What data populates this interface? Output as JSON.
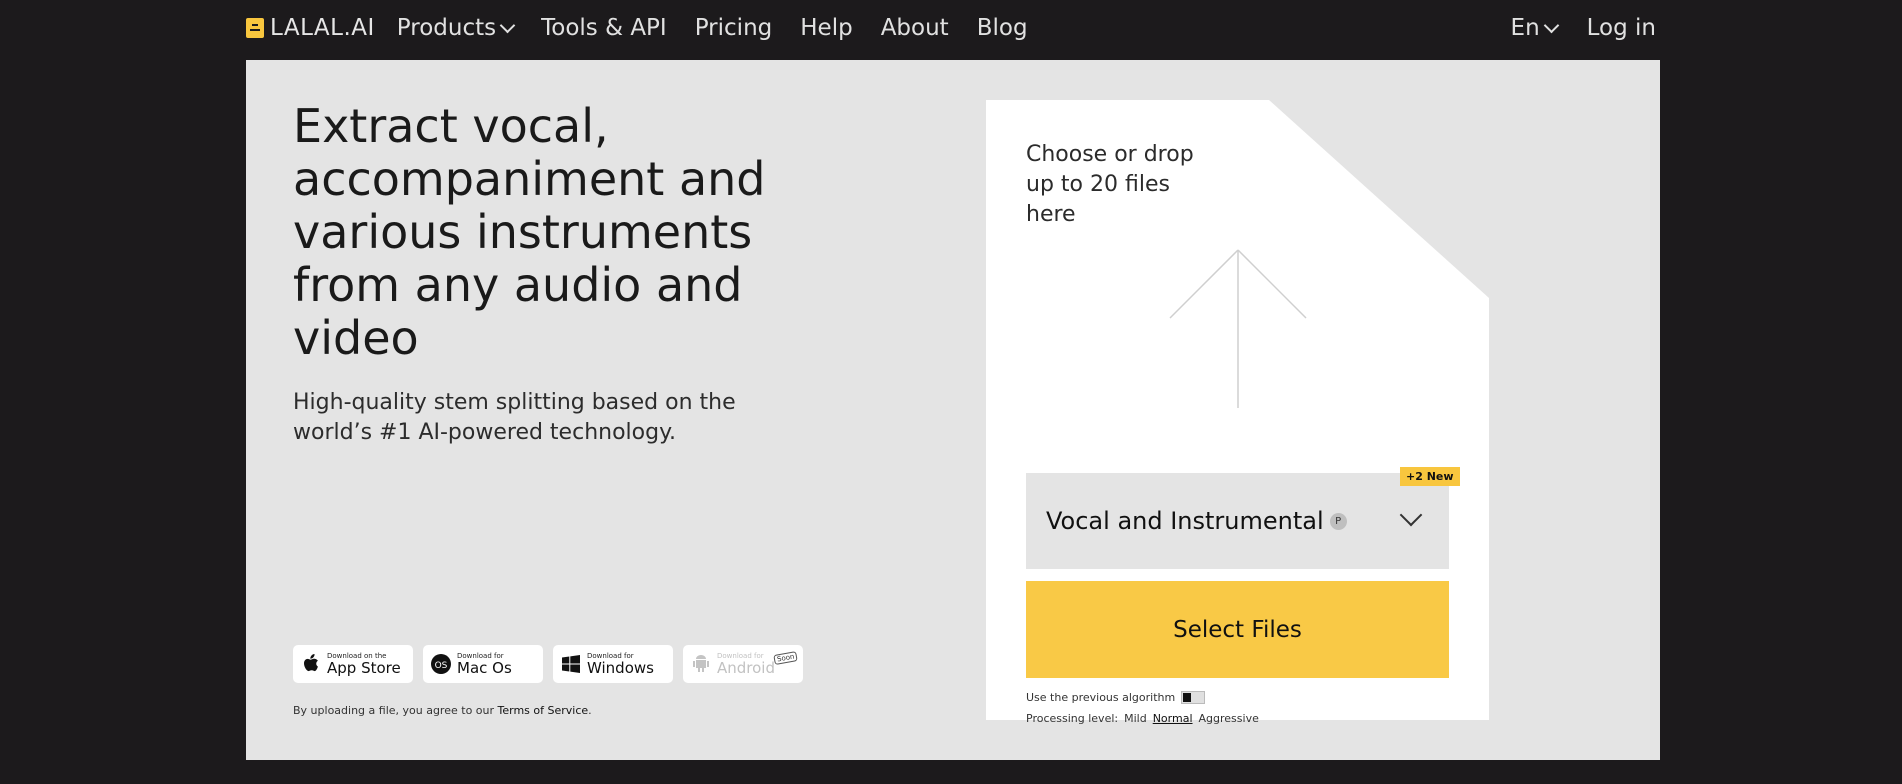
{
  "header": {
    "logo": "LALAL.AI",
    "nav": [
      {
        "label": "Products",
        "dropdown": true
      },
      {
        "label": "Tools & API"
      },
      {
        "label": "Pricing"
      },
      {
        "label": "Help"
      },
      {
        "label": "About"
      },
      {
        "label": "Blog"
      }
    ],
    "language": "En",
    "login": "Log in"
  },
  "hero": {
    "headline": "Extract vocal, accompaniment and various instruments from any audio and video",
    "subline": "High-quality stem splitting based on the world’s #1 AI-powered technology."
  },
  "stores": [
    {
      "small": "Download on the",
      "big": "App Store",
      "icon": "apple-icon"
    },
    {
      "small": "Download for",
      "big": "Mac Os",
      "icon": "macos-icon"
    },
    {
      "small": "Download for",
      "big": "Windows",
      "icon": "windows-icon"
    },
    {
      "small": "Download for",
      "big": "Android",
      "icon": "android-icon",
      "badge": "Soon"
    }
  ],
  "terms": {
    "prefix": "By uploading a file, you agree to our ",
    "link": "Terms of Service",
    "suffix": "."
  },
  "upload": {
    "drop_text": "Choose or drop up to 20 files here",
    "stem_select": "Vocal and Instrumental",
    "premium_badge": "P",
    "new_badge": "+2 New",
    "select_button": "Select Files",
    "previous_algorithm": "Use the previous algorithm",
    "processing_label": "Processing level:",
    "levels": [
      "Mild",
      "Normal",
      "Aggressive"
    ],
    "active_level": "Normal"
  },
  "colors": {
    "accent": "#f9c946",
    "background": "#1c1a1c",
    "panel": "#e4e4e4"
  }
}
